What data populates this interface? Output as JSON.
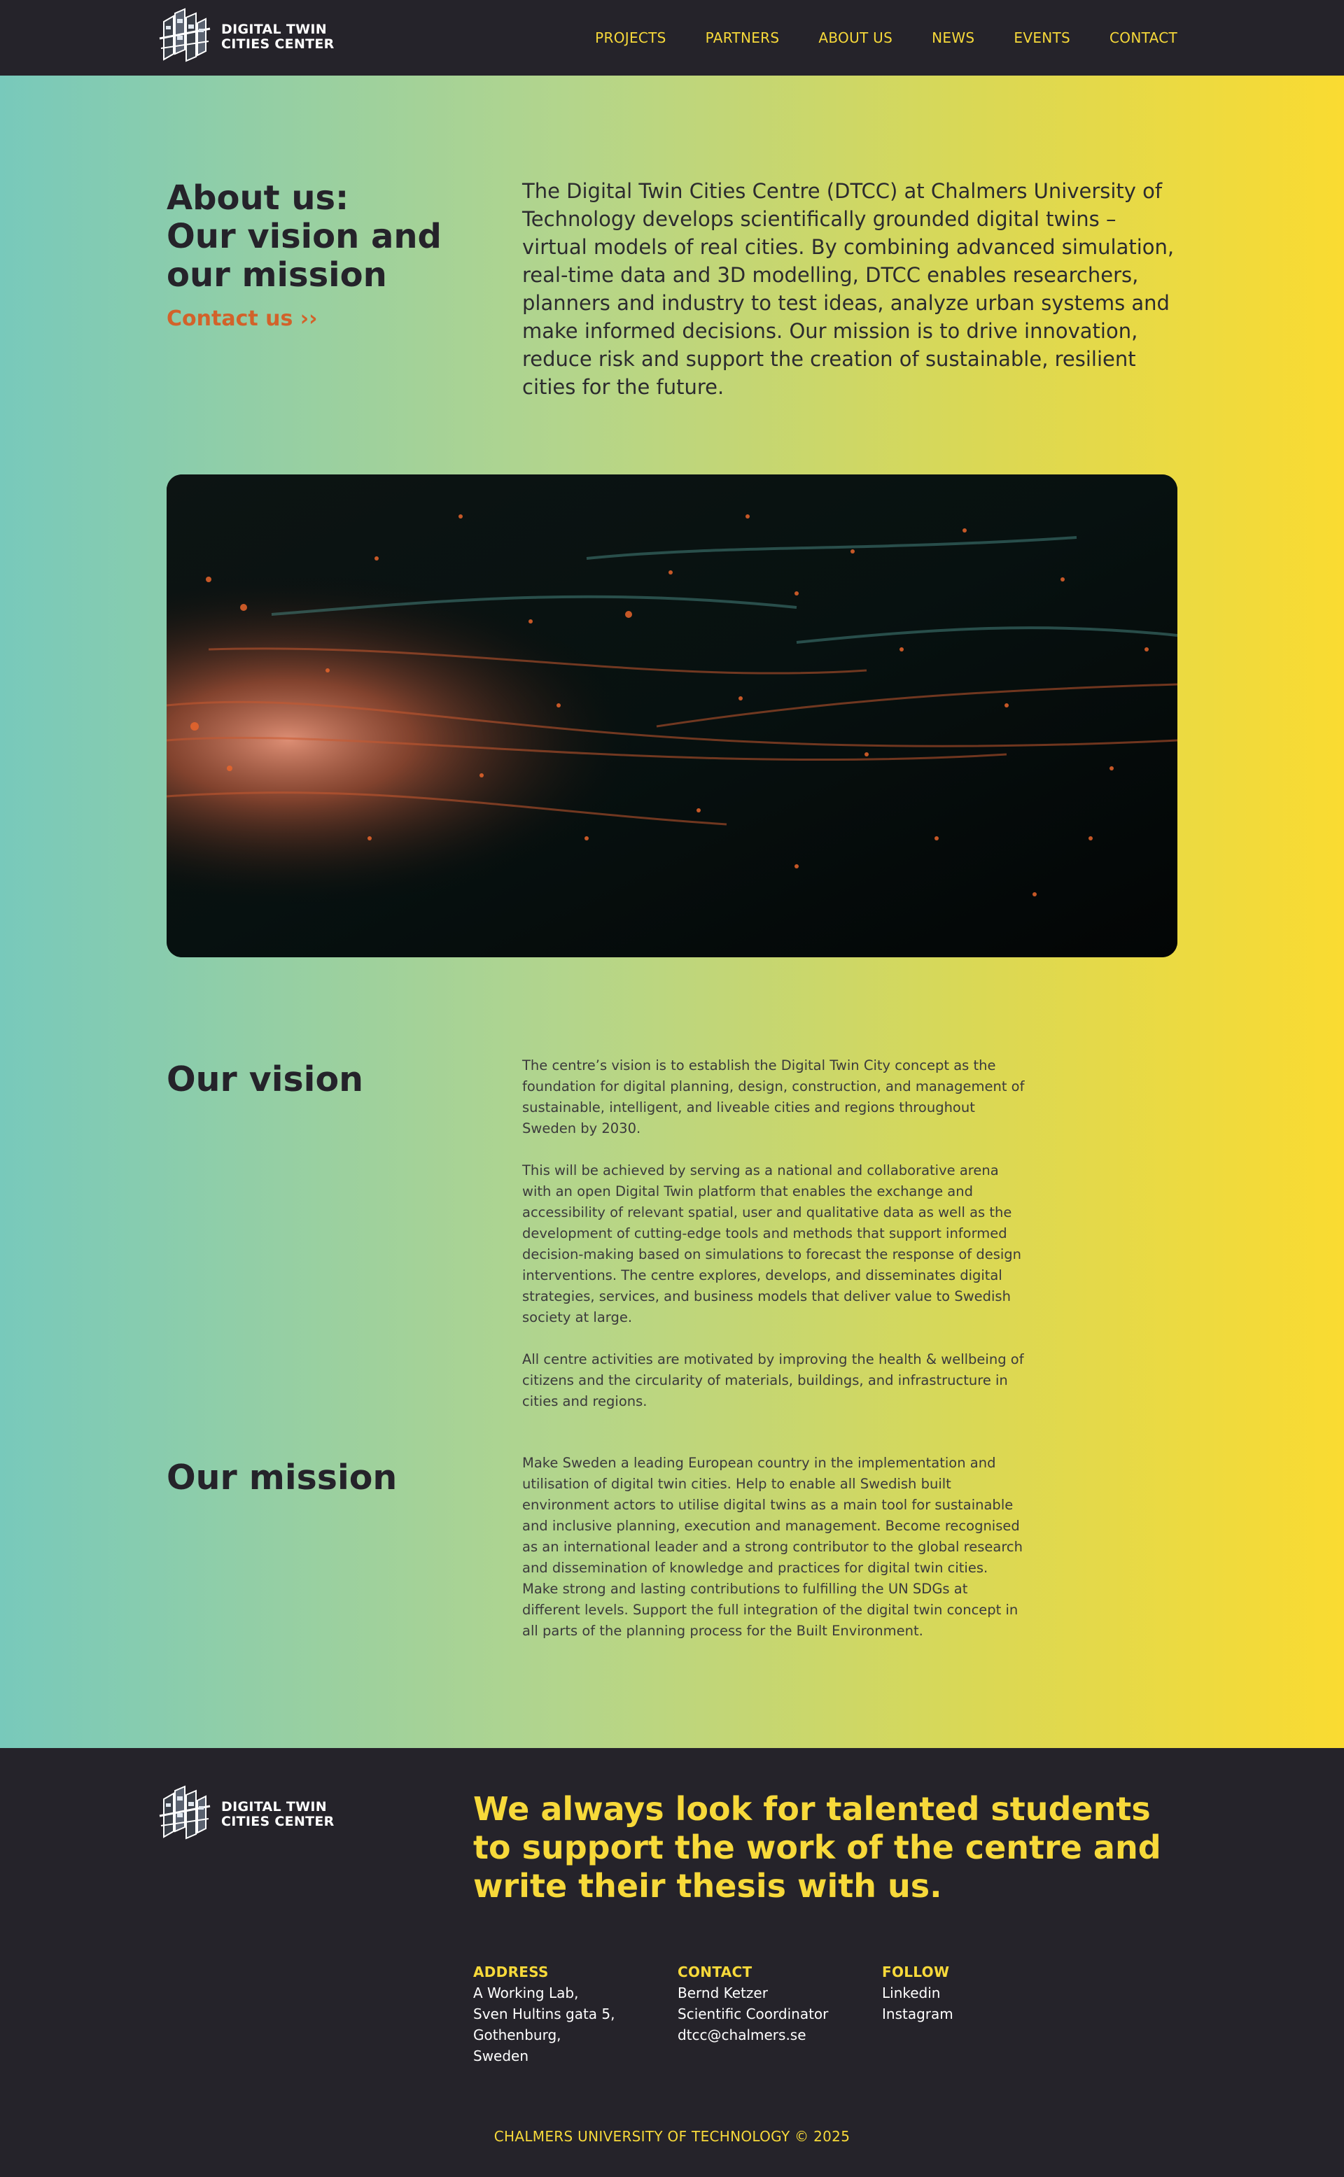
{
  "brand": {
    "name_line1": "DIGITAL TWIN",
    "name_line2": "CITIES CENTER"
  },
  "nav": [
    {
      "label": "PROJECTS"
    },
    {
      "label": "PARTNERS"
    },
    {
      "label": "ABOUT US"
    },
    {
      "label": "NEWS"
    },
    {
      "label": "EVENTS"
    },
    {
      "label": "CONTACT"
    }
  ],
  "about": {
    "heading_line1": "About us:",
    "heading_line2": "Our vision and",
    "heading_line3": "our mission",
    "contact_link": "Contact us ››",
    "intro": "The Digital Twin Cities Centre (DTCC) at Chalmers University of Technology develops scientifically grounded digital twins – virtual models of real cities. By combining advanced simulation, real-time data and 3D modelling, DTCC enables researchers, planners and industry to test ideas, analyze urban systems and make informed decisions. Our mission is to drive innovation, reduce risk and support the creation of sustainable, resilient cities for the future."
  },
  "vision": {
    "title": "Our vision",
    "paragraphs": [
      "The centre’s vision is to establish the Digital Twin City concept as the foundation for digital planning, design, construction, and management of sustainable, intelligent, and liveable cities and regions throughout Sweden by 2030.",
      "This will be achieved by serving as a national and collaborative arena with an open Digital Twin platform that enables the exchange and accessibility of relevant spatial, user and qualitative data as well as the development of cutting-edge tools and methods that support informed decision-making based on simulations to forecast the response of design interventions. The centre explores, develops, and disseminates digital strategies, services, and business models that deliver value to Swedish society at large.",
      "All centre activities are motivated by improving the health & wellbeing of citizens and the circularity of materials, buildings, and infrastructure in cities and regions."
    ]
  },
  "mission": {
    "title": "Our mission",
    "text": "Make Sweden a leading European country in the implementation and utilisation of digital twin cities. Help to enable all Swedish built environment actors to utilise digital twins as a main tool for sustainable and inclusive planning, execution and management. Become recognised as an international leader and a strong contributor to the global research and dissemination of knowledge and practices for digital twin cities. Make strong and lasting contributions to fulfilling the UN SDGs at different levels. Support the full integration of the digital twin concept in all parts of the planning process for the Built Environment."
  },
  "footer": {
    "recruit": "We always look for talented students to support the work of the centre and write their thesis with us.",
    "address": {
      "heading": "ADDRESS",
      "lines": [
        "A Working Lab,",
        "Sven Hultins gata 5,",
        "Gothenburg,",
        "Sweden"
      ]
    },
    "contact": {
      "heading": "CONTACT",
      "lines": [
        "Bernd Ketzer",
        "Scientific Coordinator",
        "dtcc@chalmers.se"
      ]
    },
    "follow": {
      "heading": "FOLLOW",
      "links": [
        "Linkedin",
        "Instagram"
      ]
    },
    "copyright": "CHALMERS UNIVERSITY OF TECHNOLOGY © 2025"
  },
  "colors": {
    "dark": "#25232a",
    "accent_yellow": "#f7d93a",
    "accent_orange": "#d2622a",
    "gradient_start": "#78c9bb",
    "gradient_end": "#fadb31"
  },
  "icons": {
    "logo": "city-buildings-logo-icon"
  }
}
